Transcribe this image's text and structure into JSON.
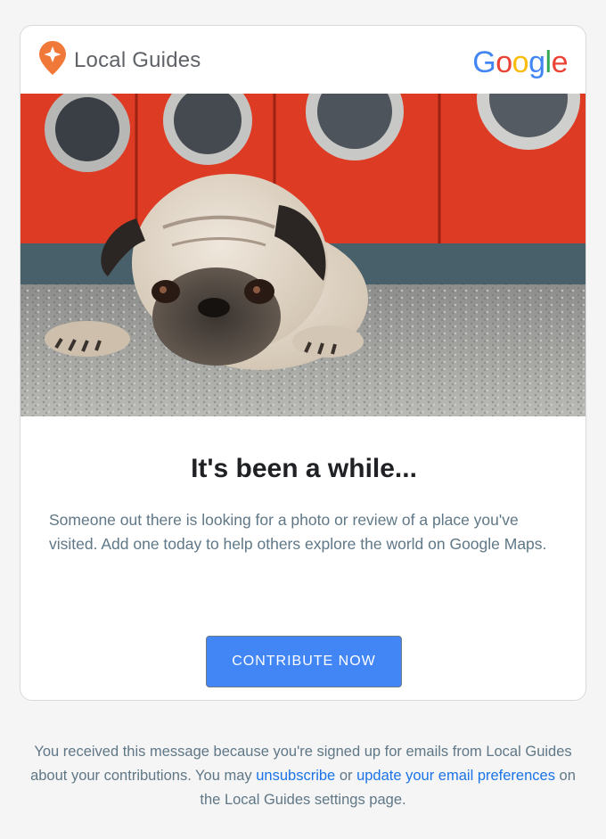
{
  "header": {
    "brand_name": "Local Guides",
    "google_logo": [
      "G",
      "o",
      "o",
      "g",
      "l",
      "e"
    ],
    "pin_icon": "local-guides-pin-icon"
  },
  "hero": {
    "image": "pug-laundromat-photo"
  },
  "main": {
    "headline": "It's been a while...",
    "body": "Someone out there is looking for a photo or review of a place you've visited. Add one today to help others explore the world on Google Maps.",
    "cta_label": "CONTRIBUTE NOW"
  },
  "footer": {
    "text_1": "You received this message because you're signed up for emails from Local Guides about your contributions. You may ",
    "unsubscribe_label": "unsubscribe",
    "text_2": " or ",
    "preferences_label": "update your email preferences",
    "text_3": " on the Local Guides settings page."
  },
  "colors": {
    "accent": "#4285f4",
    "pin_orange": "#f07838",
    "link": "#1a73e8",
    "body_text": "#5f7786"
  }
}
